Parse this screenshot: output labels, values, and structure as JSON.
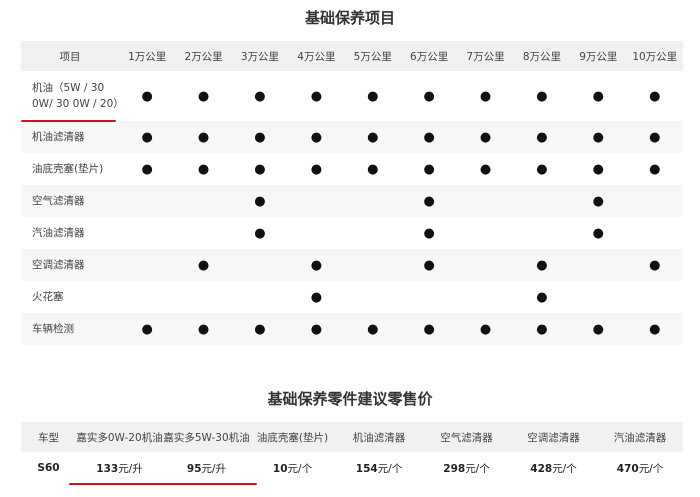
{
  "schedule": {
    "title": "基础保养项目",
    "header_first": "项目",
    "columns": [
      "1万公里",
      "2万公里",
      "3万公里",
      "4万公里",
      "5万公里",
      "6万公里",
      "7万公里",
      "8万公里",
      "9万公里",
      "10万公里"
    ],
    "mark_symbol": "●",
    "rows": [
      {
        "name": "机油（5W / 30 0W/ 30 0W / 20）",
        "marks": [
          1,
          1,
          1,
          1,
          1,
          1,
          1,
          1,
          1,
          1
        ]
      },
      {
        "name": "机油滤清器",
        "marks": [
          1,
          1,
          1,
          1,
          1,
          1,
          1,
          1,
          1,
          1
        ]
      },
      {
        "name": "油底壳塞(垫片)",
        "marks": [
          1,
          1,
          1,
          1,
          1,
          1,
          1,
          1,
          1,
          1
        ]
      },
      {
        "name": "空气滤清器",
        "marks": [
          0,
          0,
          1,
          0,
          0,
          1,
          0,
          0,
          1,
          0
        ]
      },
      {
        "name": "汽油滤清器",
        "marks": [
          0,
          0,
          1,
          0,
          0,
          1,
          0,
          0,
          1,
          0
        ]
      },
      {
        "name": "空调滤清器",
        "marks": [
          0,
          1,
          0,
          1,
          0,
          1,
          0,
          1,
          0,
          1
        ]
      },
      {
        "name": "火花塞",
        "marks": [
          0,
          0,
          0,
          1,
          0,
          0,
          0,
          1,
          0,
          0
        ]
      },
      {
        "name": "车辆检测",
        "marks": [
          1,
          1,
          1,
          1,
          1,
          1,
          1,
          1,
          1,
          1
        ]
      }
    ]
  },
  "prices": {
    "title": "基础保养零件建议零售价",
    "headers": [
      "车型",
      "嘉实多0W-20机油",
      "嘉实多5W-30机油",
      "油底壳塞(垫片)",
      "机油滤清器",
      "空气滤清器",
      "空调滤清器",
      "汽油滤清器"
    ],
    "row": {
      "model": "S60",
      "cells": [
        {
          "num": "133",
          "unit": "元/升"
        },
        {
          "num": "95",
          "unit": "元/升"
        },
        {
          "num": "10",
          "unit": "元/个"
        },
        {
          "num": "154",
          "unit": "元/个"
        },
        {
          "num": "298",
          "unit": "元/个"
        },
        {
          "num": "428",
          "unit": "元/个"
        },
        {
          "num": "470",
          "unit": "元/个"
        }
      ]
    }
  },
  "colors": {
    "highlight_underline": "#d0131b",
    "header_bg": "#f1f1f1",
    "stripe_bg": "#f7f7f7"
  }
}
